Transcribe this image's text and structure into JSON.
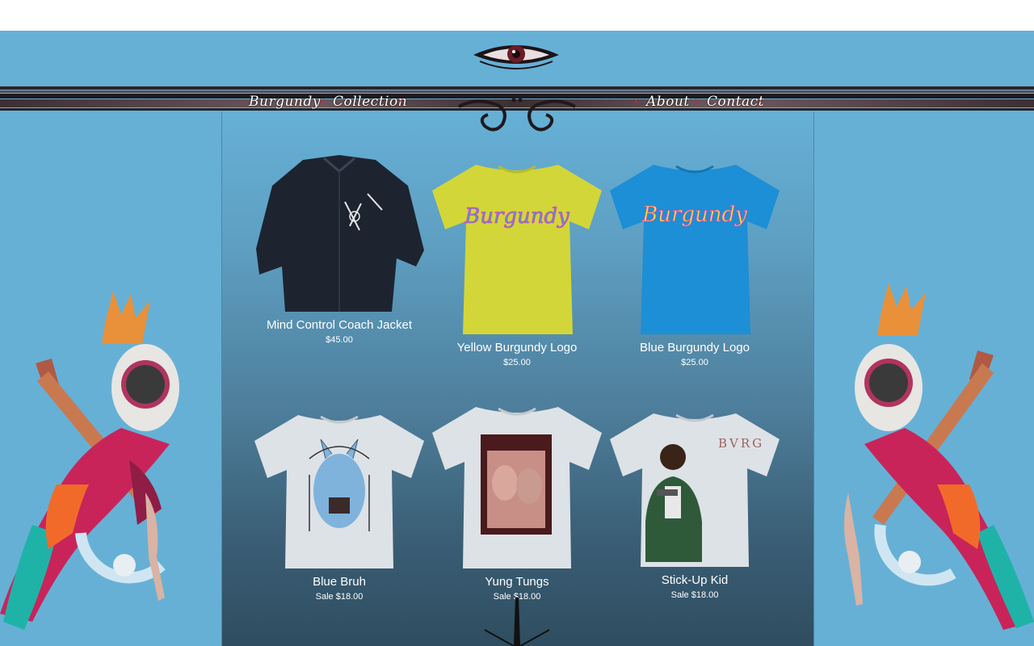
{
  "nav": {
    "left": [
      {
        "label": "Burgundy"
      },
      {
        "label": "Collection"
      }
    ],
    "right": [
      {
        "label": "About"
      },
      {
        "label": "Contact"
      }
    ],
    "separator": "×"
  },
  "products": [
    {
      "name": "Mind Control Coach Jacket",
      "price": "$45.00",
      "kind": "jacket"
    },
    {
      "name": "Yellow Burgundy Logo",
      "price": "$25.00",
      "kind": "yellow-tee"
    },
    {
      "name": "Blue Burgundy Logo",
      "price": "$25.00",
      "kind": "blue-tee"
    },
    {
      "name": "Blue Bruh",
      "price": "Sale $18.00",
      "kind": "white-tee-rhino"
    },
    {
      "name": "Yung Tungs",
      "price": "Sale $18.00",
      "kind": "white-tee-photo"
    },
    {
      "name": "Stick-Up Kid",
      "price": "Sale $18.00",
      "kind": "white-tee-kid"
    }
  ],
  "tee_logo_text": "Burgundy",
  "bvrg_text": "BVRG",
  "colors": {
    "background": "#66b0d6",
    "accent": "#b8323f"
  }
}
